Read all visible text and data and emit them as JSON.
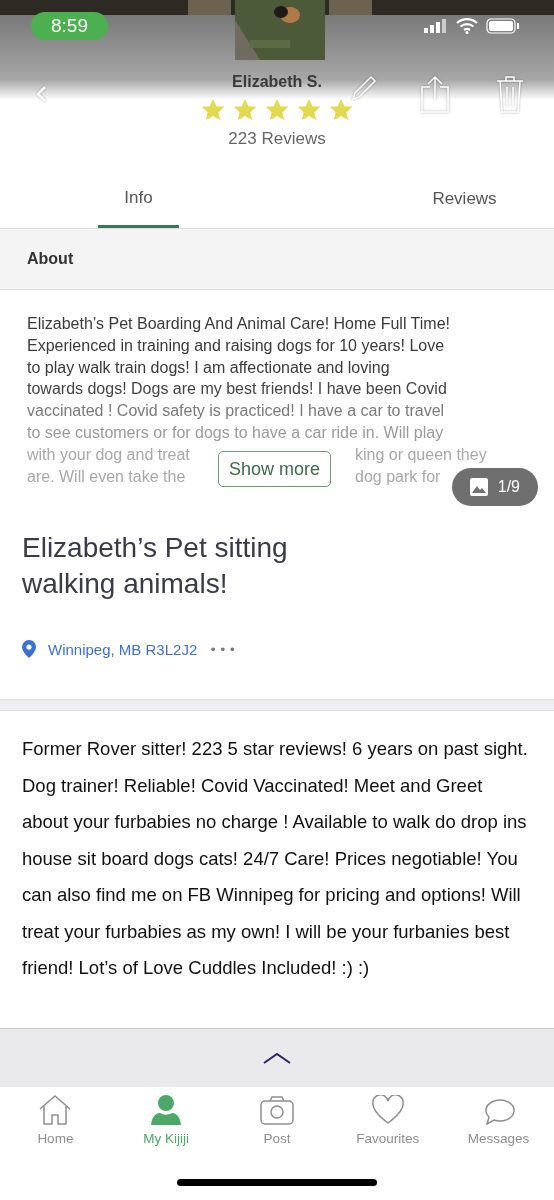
{
  "status_bar": {
    "time": "8:59"
  },
  "profile": {
    "name": "Elizabeth S.",
    "stars": 5,
    "reviews": "223 Reviews"
  },
  "tabs": [
    {
      "label": "Info",
      "selected": true
    },
    {
      "label": "Reviews",
      "selected": false
    }
  ],
  "about": {
    "heading": "About",
    "lines": [
      "Elizabeth’s Pet Boarding And Animal Care! Home Full Time!",
      "Experienced in training and raising dogs for 10 years! Love",
      "to play walk train dogs! I am affectionate and loving",
      "towards dogs! Dogs are my best friends! I have been Covid",
      "vaccinated ! Covid safety is practiced! I have a car to travel",
      "to see customers or for dogs to have a car ride in. Will play"
    ],
    "covered_lines": [
      {
        "left": "with your dog and treat",
        "right": "king or queen they"
      },
      {
        "left": "are. Will even take the",
        "right": "dog park for"
      }
    ],
    "show_more": "Show more",
    "photo_count": "1/9"
  },
  "listing": {
    "title": "Elizabeth’s Pet sitting walking animals!",
    "location": "Winnipeg, MB R3L2J2",
    "more": "•••"
  },
  "description": "Former Rover sitter! 223 5 star reviews! 6 years on past sight. Dog trainer! Reliable! Covid Vaccinated! Meet and Greet about your furbabies no charge ! Available to walk do drop ins house sit board dogs cats! 24/7 Care! Prices negotiable! You can also find me on FB Winnipeg for pricing and options! Will treat your furbabies as my own! I will be your furbanies best friend! Lot’s of Love Cuddles Included! :) :)",
  "nav": [
    {
      "label": "Home",
      "selected": false
    },
    {
      "label": "My Kijiji",
      "selected": true
    },
    {
      "label": "Post",
      "selected": false
    },
    {
      "label": "Favourites",
      "selected": false
    },
    {
      "label": "Messages",
      "selected": false
    }
  ]
}
